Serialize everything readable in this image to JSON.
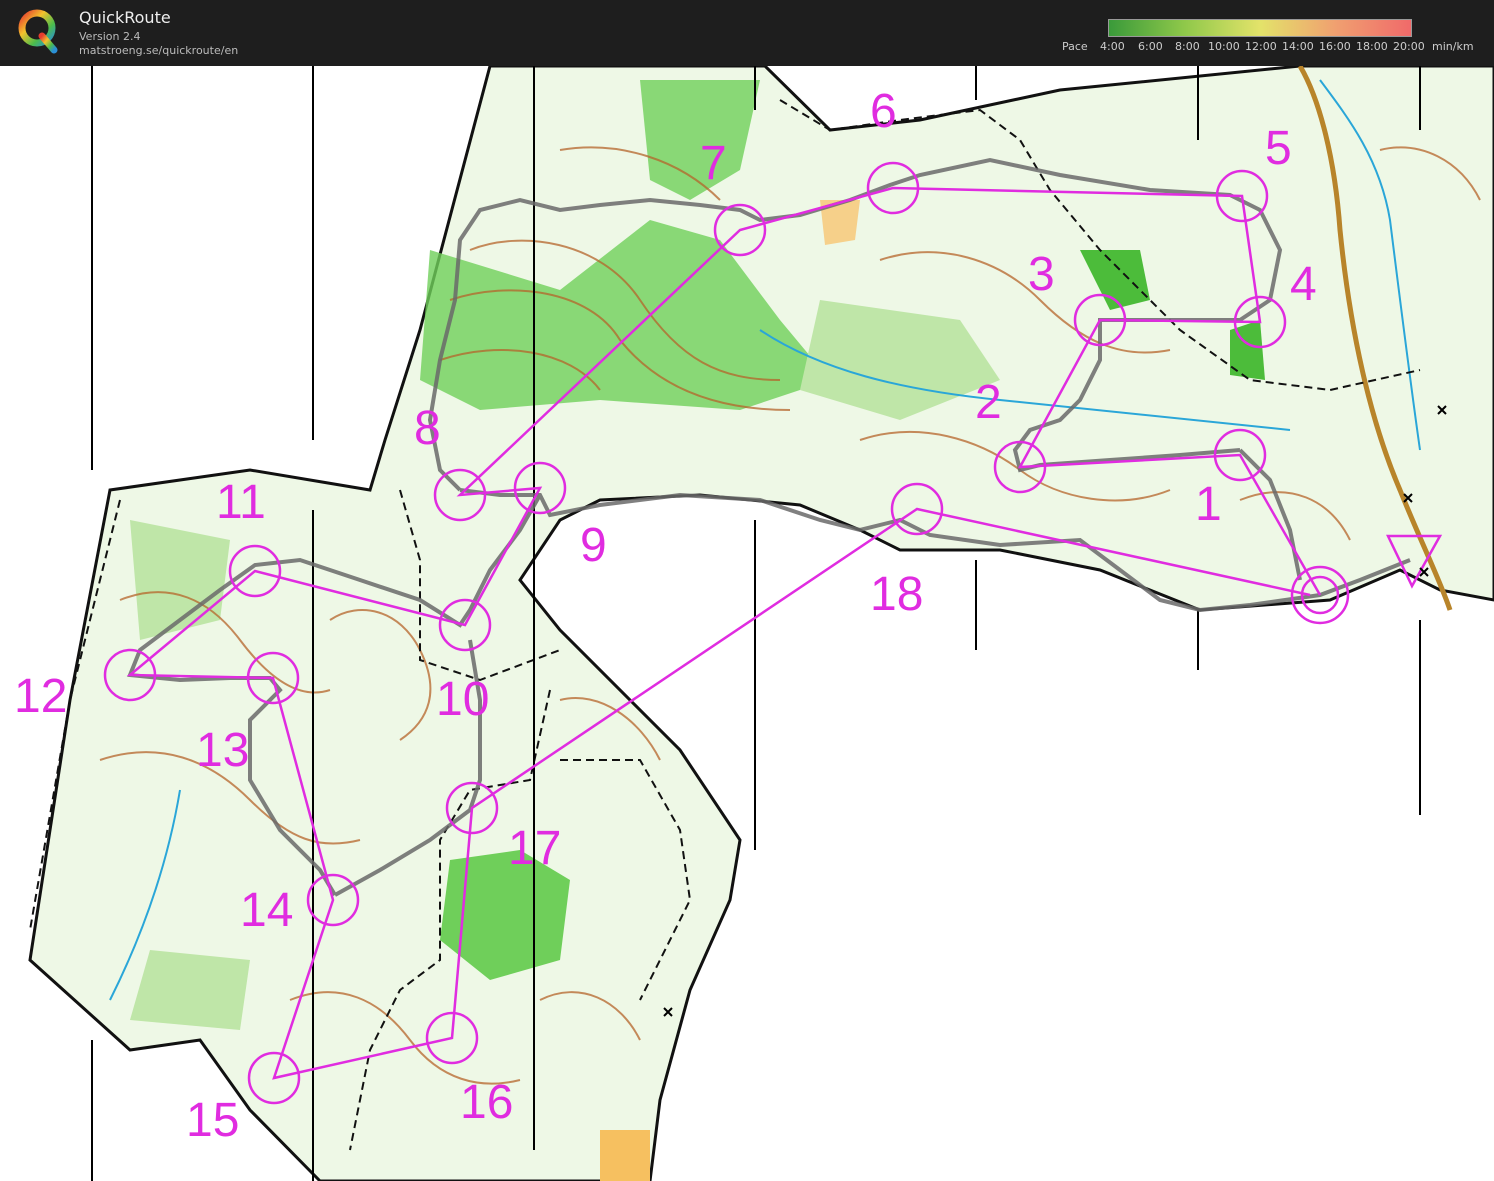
{
  "header": {
    "app_name": "QuickRoute",
    "version": "Version 2.4",
    "url": "matstroeng.se/quickroute/en",
    "logo_letter": "Q"
  },
  "pace_legend": {
    "label": "Pace",
    "ticks": [
      "4:00",
      "6:00",
      "8:00",
      "10:00",
      "12:00",
      "14:00",
      "16:00",
      "18:00",
      "20:00"
    ],
    "unit": "min/km",
    "colors": [
      "#3a9a3a",
      "#8fc84a",
      "#e3e36a",
      "#f0a070",
      "#f06a6a"
    ]
  },
  "map": {
    "course_color": "#e02ce0",
    "route_color": "#6a6a6a",
    "controls": [
      {
        "label": "1"
      },
      {
        "label": "2"
      },
      {
        "label": "3"
      },
      {
        "label": "4"
      },
      {
        "label": "5"
      },
      {
        "label": "6"
      },
      {
        "label": "7"
      },
      {
        "label": "8"
      },
      {
        "label": "9"
      },
      {
        "label": "10"
      },
      {
        "label": "11"
      },
      {
        "label": "12"
      },
      {
        "label": "13"
      },
      {
        "label": "14"
      },
      {
        "label": "15"
      },
      {
        "label": "16"
      },
      {
        "label": "17"
      },
      {
        "label": "18"
      }
    ]
  }
}
